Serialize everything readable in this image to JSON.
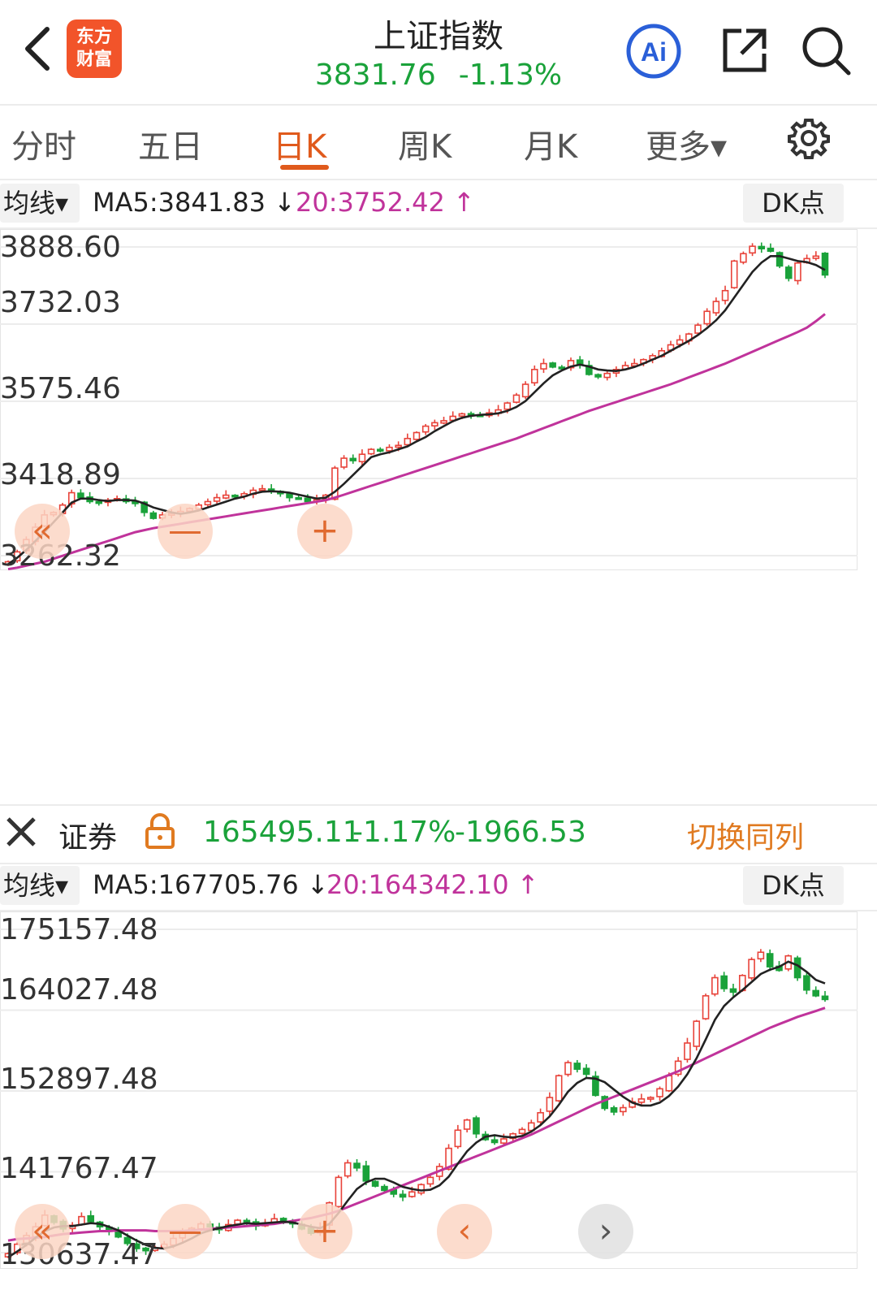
{
  "header": {
    "title": "上证指数",
    "price": "3831.76",
    "change_pct": "-1.13%",
    "logo_line1": "东方",
    "logo_line2": "财富",
    "ai_label": "Ai"
  },
  "tabs": [
    {
      "label": "分时"
    },
    {
      "label": "五日"
    },
    {
      "label": "日K"
    },
    {
      "label": "周K"
    },
    {
      "label": "月K"
    },
    {
      "label": "更多▾"
    }
  ],
  "active_tab": "日K",
  "index_chart": {
    "ma_select_label": "均线▾",
    "ma5_text": "MA5:3841.83 ↓",
    "ma20_text": "20:3752.42 ↑",
    "dk_label": "DK点",
    "y_ticks": [
      "3888.60",
      "3732.03",
      "3575.46",
      "3418.89",
      "3262.32"
    ]
  },
  "sector_bar": {
    "close_icon": "close-icon",
    "name": "证券",
    "lock_icon": "lock-icon",
    "value": "165495.11",
    "change_pct": "-1.17%",
    "change": "-1966.53",
    "switch_label": "切换同列"
  },
  "sector_chart": {
    "ma_select_label": "均线▾",
    "ma5_text": "MA5:167705.76 ↓",
    "ma20_text": "20:164342.10 ↑",
    "dk_label": "DK点",
    "y_ticks": [
      "175157.48",
      "164027.48",
      "152897.48",
      "141767.47",
      "130637.47"
    ]
  },
  "chart_controls": {
    "scroll_left": "«",
    "zoom_out": "—",
    "zoom_in": "+",
    "prev": "‹",
    "next": "›"
  },
  "colors": {
    "up": "#e8433a",
    "down": "#1aa23a",
    "ma5": "#222222",
    "ma20": "#c0339b",
    "accent": "#e05a1c"
  },
  "chart_data": [
    {
      "type": "candlestick",
      "title": "上证指数",
      "ylim": [
        3262.32,
        3888.6
      ],
      "yticks": [
        3888.6,
        3732.03,
        3575.46,
        3418.89,
        3262.32
      ],
      "close": [
        3250,
        3270,
        3295,
        3320,
        3345,
        3350,
        3365,
        3390,
        3380,
        3372,
        3370,
        3375,
        3378,
        3372,
        3368,
        3350,
        3338,
        3345,
        3348,
        3352,
        3358,
        3365,
        3372,
        3380,
        3385,
        3382,
        3388,
        3395,
        3398,
        3392,
        3388,
        3380,
        3378,
        3372,
        3376,
        3385,
        3440,
        3460,
        3455,
        3468,
        3478,
        3476,
        3482,
        3486,
        3500,
        3512,
        3525,
        3532,
        3536,
        3545,
        3550,
        3548,
        3546,
        3552,
        3558,
        3572,
        3588,
        3610,
        3640,
        3652,
        3645,
        3642,
        3658,
        3650,
        3630,
        3625,
        3632,
        3640,
        3648,
        3652,
        3660,
        3668,
        3678,
        3690,
        3700,
        3712,
        3730,
        3758,
        3778,
        3800,
        3860,
        3875,
        3890,
        3885,
        3880,
        3850,
        3825,
        3856,
        3865,
        3870,
        3831.76
      ],
      "ma5": [
        3245,
        3258,
        3274,
        3292,
        3310,
        3330,
        3350,
        3370,
        3378,
        3378,
        3375,
        3373,
        3375,
        3375,
        3374,
        3368,
        3360,
        3355,
        3350,
        3347,
        3350,
        3354,
        3360,
        3366,
        3372,
        3378,
        3382,
        3388,
        3392,
        3393,
        3392,
        3390,
        3386,
        3382,
        3378,
        3380,
        3392,
        3408,
        3426,
        3444,
        3462,
        3468,
        3472,
        3478,
        3484,
        3494,
        3503,
        3515,
        3525,
        3535,
        3542,
        3546,
        3548,
        3549,
        3551,
        3556,
        3564,
        3576,
        3594,
        3612,
        3628,
        3638,
        3646,
        3650,
        3646,
        3640,
        3638,
        3637,
        3640,
        3645,
        3652,
        3660,
        3668,
        3678,
        3688,
        3698,
        3710,
        3724,
        3740,
        3760,
        3786,
        3812,
        3838,
        3857,
        3870,
        3870,
        3865,
        3860,
        3858,
        3852,
        3841.83
      ],
      "ma20": [
        3235,
        3238,
        3242,
        3246,
        3250,
        3256,
        3262,
        3268,
        3274,
        3280,
        3286,
        3292,
        3298,
        3304,
        3310,
        3314,
        3318,
        3321,
        3324,
        3327,
        3330,
        3333,
        3336,
        3339,
        3342,
        3345,
        3348,
        3351,
        3354,
        3357,
        3360,
        3363,
        3366,
        3369,
        3372,
        3375,
        3380,
        3386,
        3392,
        3398,
        3404,
        3410,
        3416,
        3422,
        3428,
        3434,
        3440,
        3446,
        3452,
        3458,
        3464,
        3470,
        3476,
        3482,
        3488,
        3494,
        3500,
        3507,
        3514,
        3521,
        3528,
        3535,
        3542,
        3549,
        3556,
        3562,
        3568,
        3574,
        3580,
        3586,
        3592,
        3598,
        3604,
        3610,
        3617,
        3624,
        3631,
        3638,
        3645,
        3652,
        3660,
        3668,
        3676,
        3684,
        3692,
        3700,
        3708,
        3716,
        3725,
        3738,
        3752.42
      ]
    },
    {
      "type": "candlestick",
      "title": "证券",
      "ylim": [
        130637.47,
        175157.48
      ],
      "yticks": [
        175157.48,
        164027.48,
        152897.48,
        141767.47,
        130637.47
      ],
      "close": [
        130500,
        131800,
        133000,
        134200,
        135800,
        134800,
        133900,
        134400,
        135600,
        134900,
        134200,
        133600,
        132800,
        131900,
        131200,
        130900,
        131300,
        131800,
        132600,
        133300,
        134000,
        134600,
        134200,
        133800,
        134500,
        135100,
        134800,
        134300,
        134700,
        135300,
        135000,
        134600,
        133900,
        133300,
        134100,
        137500,
        141000,
        143000,
        142300,
        140500,
        139800,
        139200,
        138700,
        138300,
        139000,
        140000,
        141000,
        142500,
        145000,
        147500,
        148900,
        147000,
        146200,
        145800,
        146300,
        147000,
        147600,
        148500,
        149900,
        152000,
        155000,
        156800,
        155900,
        155200,
        152300,
        150500,
        150000,
        150600,
        151400,
        151800,
        152000,
        153200,
        155000,
        157000,
        159500,
        162500,
        166000,
        168500,
        167000,
        166500,
        168800,
        171000,
        172000,
        170000,
        169500,
        171500,
        168500,
        166800,
        166000,
        165495.11
      ],
      "ma5": [
        130000,
        130800,
        131700,
        132700,
        133600,
        134100,
        134300,
        134300,
        134500,
        134700,
        134600,
        134200,
        133700,
        133000,
        132300,
        131700,
        131300,
        131200,
        131500,
        132000,
        132600,
        133300,
        133700,
        134000,
        134300,
        134500,
        134700,
        134600,
        134700,
        134800,
        134900,
        134800,
        134500,
        134200,
        134000,
        134600,
        136100,
        137800,
        139400,
        140300,
        140800,
        140800,
        140300,
        139700,
        139400,
        139200,
        139300,
        139900,
        141100,
        142900,
        144600,
        145800,
        146600,
        146800,
        146600,
        146500,
        146700,
        147300,
        148200,
        149400,
        151000,
        152800,
        154000,
        154700,
        154600,
        154100,
        153100,
        152100,
        151300,
        150900,
        150900,
        151300,
        152200,
        153500,
        155200,
        157400,
        160000,
        162700,
        164600,
        165800,
        166800,
        167900,
        169000,
        169600,
        170000,
        170700,
        170200,
        169300,
        168200,
        167705.76
      ],
      "ma20": [
        132300,
        132500,
        132600,
        132700,
        132800,
        133000,
        133200,
        133300,
        133400,
        133500,
        133600,
        133600,
        133700,
        133700,
        133700,
        133700,
        133600,
        133600,
        133600,
        133600,
        133700,
        133800,
        133900,
        134000,
        134100,
        134200,
        134300,
        134400,
        134500,
        134600,
        134800,
        135000,
        135200,
        135400,
        135700,
        136000,
        136400,
        136900,
        137400,
        137900,
        138400,
        138900,
        139400,
        139900,
        140400,
        140900,
        141400,
        141900,
        142400,
        142900,
        143400,
        143900,
        144400,
        144900,
        145400,
        145900,
        146400,
        146900,
        147500,
        148100,
        148700,
        149300,
        149900,
        150500,
        151100,
        151600,
        152100,
        152600,
        153100,
        153600,
        154100,
        154600,
        155100,
        155600,
        156200,
        156800,
        157400,
        158000,
        158600,
        159200,
        159800,
        160400,
        161000,
        161600,
        162100,
        162600,
        163100,
        163500,
        163900,
        164342.1
      ]
    }
  ]
}
